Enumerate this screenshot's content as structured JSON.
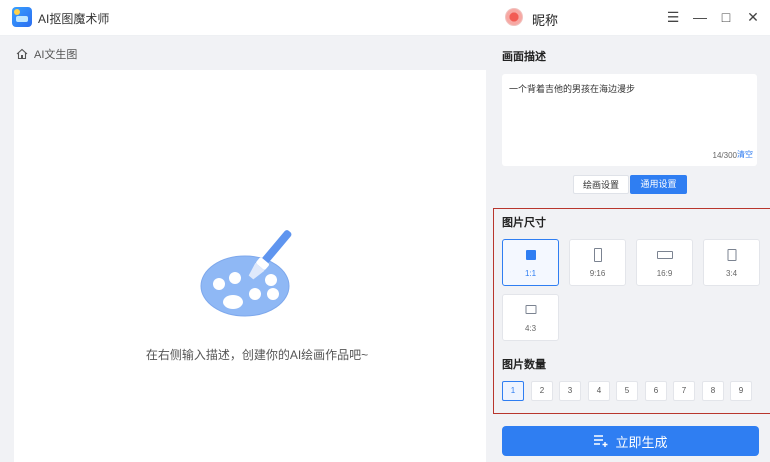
{
  "app": {
    "title": "AI抠图魔术师"
  },
  "user": {
    "nickname": "昵称"
  },
  "window_controls": {
    "menu": "☰",
    "minimize": "—",
    "maximize": "□",
    "close": "✕"
  },
  "left": {
    "breadcrumb": "AI文生图",
    "hint": "在右侧输入描述，创建你的AI绘画作品吧~"
  },
  "right": {
    "desc_title": "画面描述",
    "desc_text": "一个背着吉他的男孩在海边漫步",
    "char_count": "14/300",
    "clear_label": "清空",
    "tabs": [
      "绘画设置",
      "通用设置"
    ],
    "active_tab": "通用设置",
    "size_title": "图片尺寸",
    "sizes": [
      "1:1",
      "9:16",
      "16:9",
      "3:4",
      "4:3"
    ],
    "selected_size": "1:1",
    "count_title": "图片数量",
    "counts": [
      "1",
      "2",
      "3",
      "4",
      "5",
      "6",
      "7",
      "8",
      "9"
    ],
    "selected_count": "1",
    "generate_label": "立即生成"
  },
  "colors": {
    "accent": "#2f7ef2",
    "highlight_frame": "#b8362d",
    "panel_bg": "#f1f2f5"
  },
  "icons": {
    "home": "home-icon",
    "generate": "list-add-icon",
    "palette": "palette-illustration"
  }
}
